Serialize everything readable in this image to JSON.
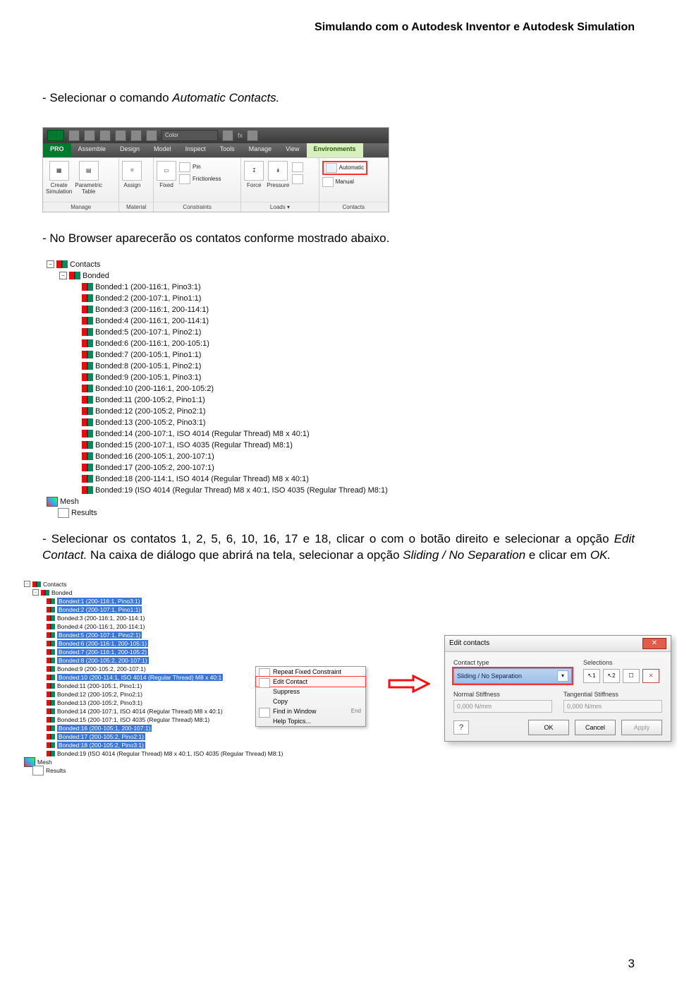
{
  "header": "Simulando com o Autodesk Inventor e Autodesk Simulation",
  "page_number": "3",
  "p1_a": "- Selecionar o comando ",
  "p1_b": "Automatic Contacts.",
  "p2": "- No Browser aparecerão os contatos conforme mostrado abaixo.",
  "p3_a": "- Selecionar os contatos 1, 2, 5, 6, 10, 16, 17 e 18, clicar o com o botão direito e selecionar a opção ",
  "p3_b": "Edit Contact. ",
  "p3_c": "Na caixa de diálogo que abrirá na tela, selecionar a opção ",
  "p3_d": "Sliding / No Separation ",
  "p3_e": "e clicar em ",
  "p3_f": "OK.",
  "ribbon": {
    "color_label": "Color",
    "tabs": [
      "Assemble",
      "Design",
      "Model",
      "Inspect",
      "Tools",
      "Manage",
      "View",
      "Environments"
    ],
    "groups": {
      "manage": {
        "create": "Create\nSimulation",
        "parametric": "Parametric\nTable",
        "label": "Manage"
      },
      "material": {
        "assign": "Assign",
        "label": "Material"
      },
      "constraints": {
        "fixed": "Fixed",
        "pin": "Pin",
        "frictionless": "Frictionless",
        "label": "Constraints"
      },
      "loads": {
        "force": "Force",
        "pressure": "Pressure",
        "label": "Loads"
      },
      "contacts": {
        "automatic": "Automatic",
        "manual": "Manual",
        "label": "Contacts"
      }
    }
  },
  "tree": {
    "root": "Contacts",
    "bonded": "Bonded",
    "items": [
      "Bonded:1 (200-116:1, Pino3:1)",
      "Bonded:2 (200-107:1, Pino1:1)",
      "Bonded:3 (200-116:1, 200-114:1)",
      "Bonded:4 (200-116:1, 200-114:1)",
      "Bonded:5 (200-107:1, Pino2:1)",
      "Bonded:6 (200-116:1, 200-105:1)",
      "Bonded:7 (200-105:1, Pino1:1)",
      "Bonded:8 (200-105:1, Pino2:1)",
      "Bonded:9 (200-105:1, Pino3:1)",
      "Bonded:10 (200-116:1, 200-105:2)",
      "Bonded:11 (200-105:2, Pino1:1)",
      "Bonded:12 (200-105:2, Pino2:1)",
      "Bonded:13 (200-105:2, Pino3:1)",
      "Bonded:14 (200-107:1, ISO 4014  (Regular Thread) M8 x 40:1)",
      "Bonded:15 (200-107:1, ISO 4035  (Regular Thread) M8:1)",
      "Bonded:16 (200-105:1, 200-107:1)",
      "Bonded:17 (200-105:2, 200-107:1)",
      "Bonded:18 (200-114:1, ISO 4014  (Regular Thread) M8 x 40:1)",
      "Bonded:19 (ISO 4014  (Regular Thread) M8 x 40:1, ISO 4035  (Regular Thread) M8:1)"
    ],
    "mesh": "Mesh",
    "results": "Results"
  },
  "tree2": {
    "root": "Contacts",
    "bonded": "Bonded",
    "items": [
      {
        "t": "Bonded:1 (200-116:1, Pino3:1)",
        "sel": true
      },
      {
        "t": "Bonded:2 (200-107:1, Pino1:1)",
        "sel": true
      },
      {
        "t": "Bonded:3 (200-116:1, 200-114:1)",
        "sel": false
      },
      {
        "t": "Bonded:4 (200-116:1, 200-114:1)",
        "sel": false
      },
      {
        "t": "Bonded:5 (200-107:1, Pino2:1)",
        "sel": true
      },
      {
        "t": "Bonded:6 (200-116:1, 200-105:1)",
        "sel": true
      },
      {
        "t": "Bonded:7 (200-116:1, 200-105:2)",
        "sel": true
      },
      {
        "t": "Bonded:8 (200-105:2, 200-107:1)",
        "sel": true
      },
      {
        "t": "Bonded:9 (200-105:2, 200-107:1)",
        "sel": false
      },
      {
        "t": "Bonded:10 (200-114:1, ISO 4014  (Regular Thread) M8 x 40:1",
        "sel": true
      },
      {
        "t": "Bonded:11 (200-105:1, Pino1:1)",
        "sel": false
      },
      {
        "t": "Bonded:12 (200-105:2, Pino2:1)",
        "sel": false
      },
      {
        "t": "Bonded:13 (200-105:2, Pino3:1)",
        "sel": false
      },
      {
        "t": "Bonded:14 (200-107:1, ISO 4014  (Regular Thread) M8 x 40:1)",
        "sel": false
      },
      {
        "t": "Bonded:15 (200-107:1, ISO 4035  (Regular Thread) M8:1)",
        "sel": false
      },
      {
        "t": "Bonded:16 (200-105:1, 200-107:1)",
        "sel": true
      },
      {
        "t": "Bonded:17 (200-105:2, Pino2:1)",
        "sel": true
      },
      {
        "t": "Bonded:18 (200-105:2, Pino3:1)",
        "sel": true
      },
      {
        "t": "Bonded:19 (ISO 4014  (Regular Thread) M8 x 40:1, ISO 4035  (Regular Thread) M8:1)",
        "sel": false
      }
    ],
    "mesh": "Mesh",
    "results": "Results"
  },
  "context_menu": {
    "items": [
      {
        "t": "Repeat Fixed Constraint",
        "i": true
      },
      {
        "t": "Edit Contact",
        "i": true,
        "hl": true
      },
      {
        "t": "Suppress",
        "i": false
      },
      {
        "t": "Copy",
        "i": false
      },
      {
        "t": "Find in Window",
        "i": true,
        "end": "End"
      },
      {
        "t": "Help Topics...",
        "i": false
      }
    ]
  },
  "dialog": {
    "title": "Edit contacts",
    "contact_type_label": "Contact type",
    "contact_type_value": "Sliding / No Separation",
    "selections_label": "Selections",
    "sel1": "1",
    "sel2": "2",
    "normal_label": "Normal Stiffness",
    "normal_value": "0,000 N/mm",
    "tang_label": "Tangential Stiffness",
    "tang_value": "0,000 N/mm",
    "ok": "OK",
    "cancel": "Cancel",
    "apply": "Apply"
  }
}
